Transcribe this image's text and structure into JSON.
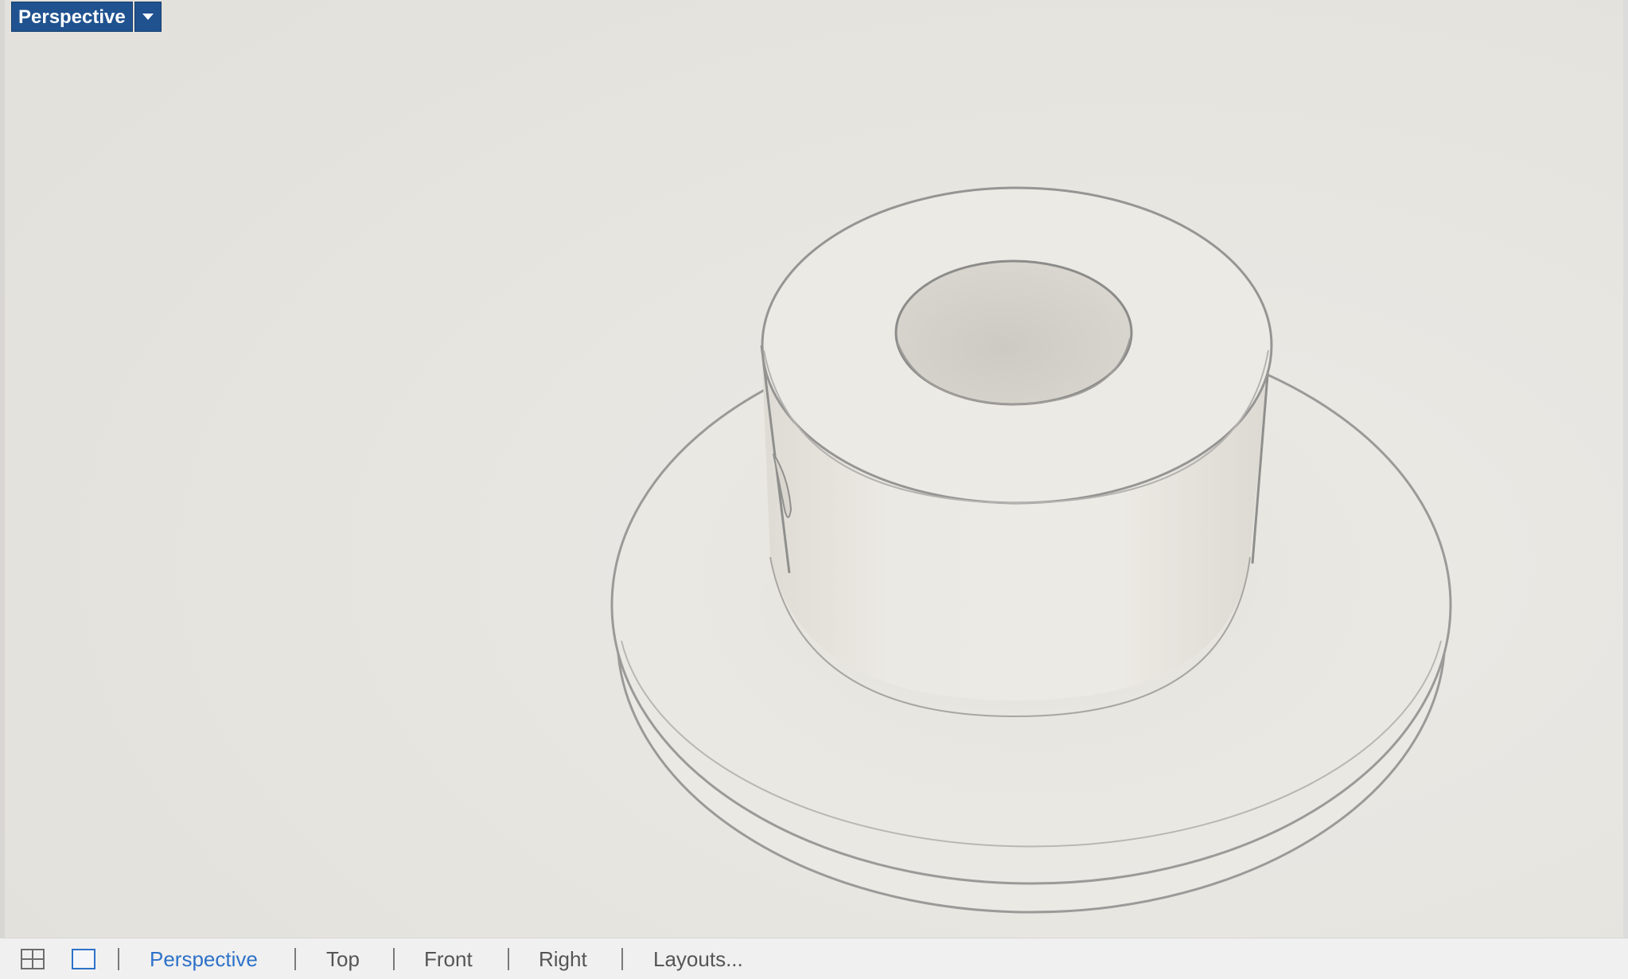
{
  "viewport": {
    "title": "Perspective",
    "dropdown_icon": "chevron-down-icon",
    "background_color": "#e9e7e1",
    "title_bg_color": "#1f528f"
  },
  "tabbar": {
    "layout_icons": [
      "four-viewports-icon",
      "single-viewport-icon"
    ],
    "tabs": [
      {
        "label": "Perspective",
        "active": true
      },
      {
        "label": "Top",
        "active": false
      },
      {
        "label": "Front",
        "active": false
      },
      {
        "label": "Right",
        "active": false
      },
      {
        "label": "Layouts...",
        "active": false
      }
    ],
    "active_color": "#2d72c8",
    "inactive_color": "#555555"
  }
}
